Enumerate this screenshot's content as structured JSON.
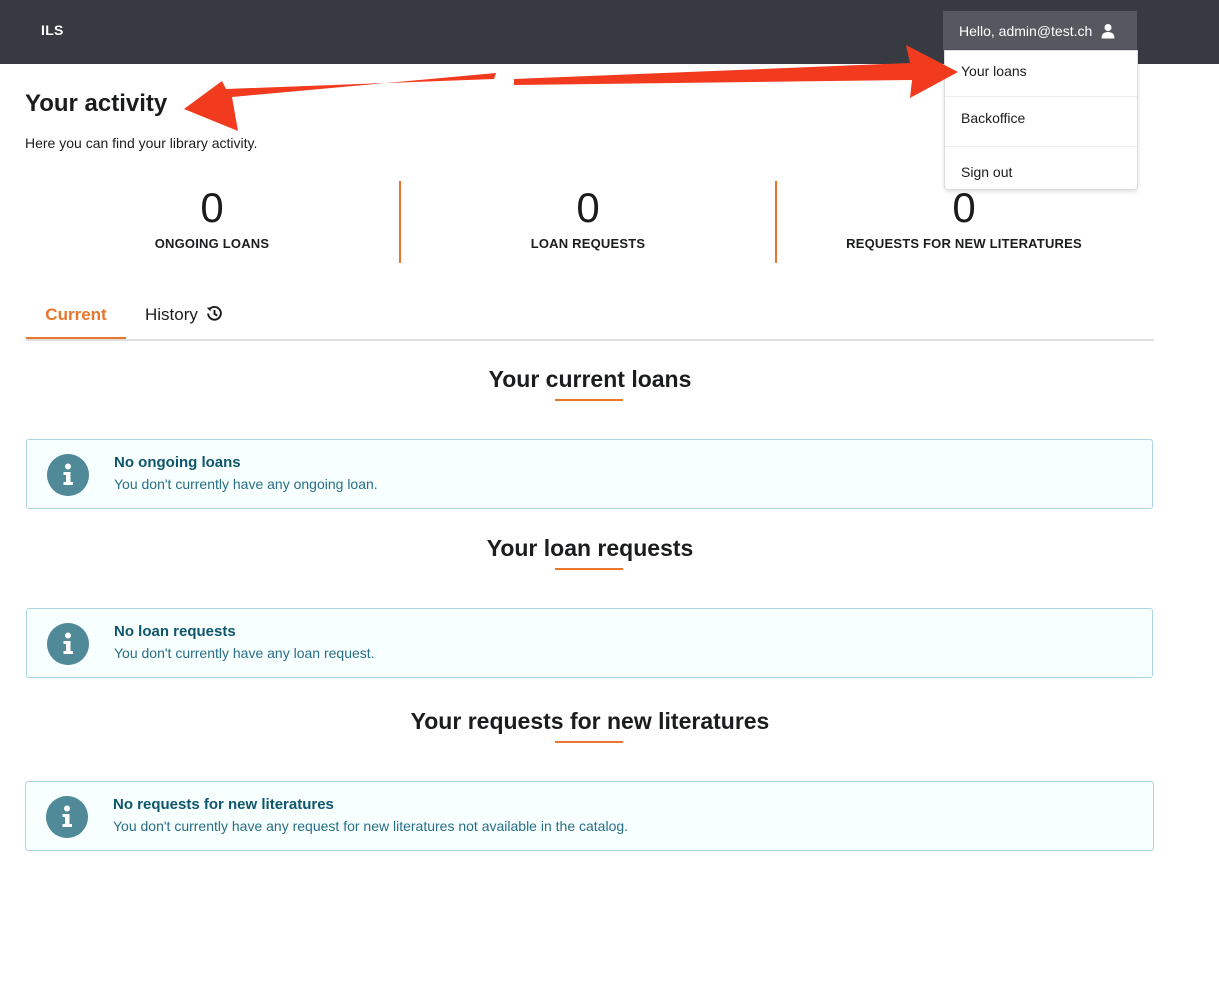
{
  "header": {
    "brand": "ILS",
    "user_greeting": "Hello, admin@test.ch",
    "user_icon": "user-icon"
  },
  "user_menu": {
    "items": [
      {
        "label": "Your loans"
      },
      {
        "label": "Backoffice"
      },
      {
        "label": "Sign out"
      }
    ]
  },
  "page": {
    "title": "Your activity",
    "subtitle": "Here you can find your library activity."
  },
  "stats": [
    {
      "value": "0",
      "label": "ONGOING LOANS"
    },
    {
      "value": "0",
      "label": "LOAN REQUESTS"
    },
    {
      "value": "0",
      "label": "REQUESTS FOR NEW LITERATURES"
    }
  ],
  "tabs": [
    {
      "label": "Current",
      "active": true
    },
    {
      "label": "History",
      "icon": "history-icon"
    }
  ],
  "sections": [
    {
      "title": "Your current loans",
      "message_title": "No ongoing loans",
      "message_text": "You don't currently have any ongoing loan."
    },
    {
      "title": "Your loan requests",
      "message_title": "No loan requests",
      "message_text": "You don't currently have any loan request."
    },
    {
      "title": "Your requests for new literatures",
      "message_title": "No requests for new literatures",
      "message_text": "You don't currently have any request for new literatures not available in the catalog."
    }
  ],
  "colors": {
    "header_bg": "#373a41",
    "accent": "#e8762d",
    "info_bg": "#f8ffff",
    "info_border": "#a9d5de",
    "info_title": "#0e566c",
    "info_text": "#276f86",
    "annotation_arrow": "#f23a1f"
  }
}
